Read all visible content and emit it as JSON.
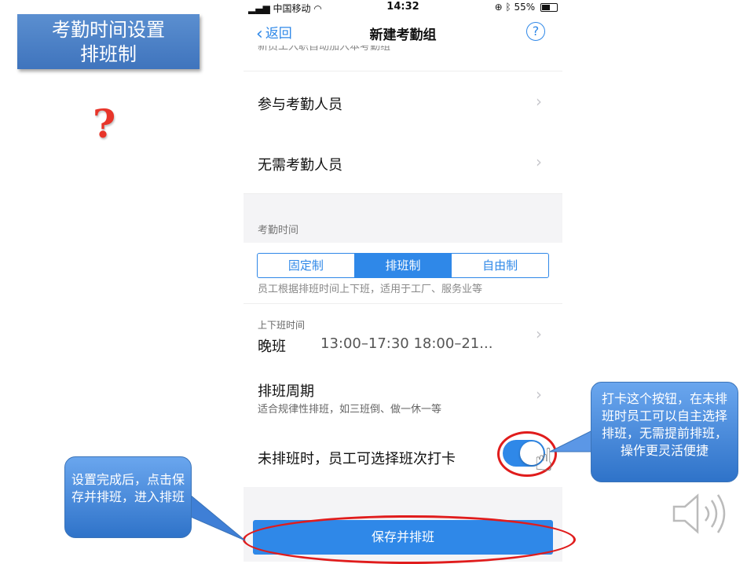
{
  "slide": {
    "title_line1": "考勤时间设置",
    "title_line2": "排班制",
    "question_mark": "?"
  },
  "status_bar": {
    "carrier": "中国移动",
    "time": "14:32",
    "battery": "55%"
  },
  "nav": {
    "back_label": "返回",
    "title": "新建考勤组",
    "help_icon": "?"
  },
  "cut_off_text": "新员工入职自动加入本考勤组",
  "rows": {
    "participants": "参与考勤人员",
    "exempt": "无需考勤人员"
  },
  "section_label": "考勤时间",
  "segments": [
    "固定制",
    "排班制",
    "自由制"
  ],
  "active_segment": "排班制",
  "segment_description": "员工根据排班时间上下班，适用于工厂、服务业等",
  "shift": {
    "label": "上下班时间",
    "name": "晚班",
    "times": "13:00–17:30  18:00–21..."
  },
  "cycle": {
    "title": "排班周期",
    "description": "适合规律性排班，如三班倒、做一休一等"
  },
  "toggle_row": {
    "label": "未排班时，员工可选择班次打卡",
    "enabled": true
  },
  "save_button": "保存并排班",
  "callouts": {
    "left": "设置完成后，点击保存并排班，进入排班",
    "right": "打卡这个按钮，在未排班时员工可以自主选择排班，无需提前排班，操作更灵活便捷"
  },
  "colors": {
    "accent": "#2f88e8",
    "highlight": "#e01c1c",
    "callout": "#4a8de0"
  }
}
